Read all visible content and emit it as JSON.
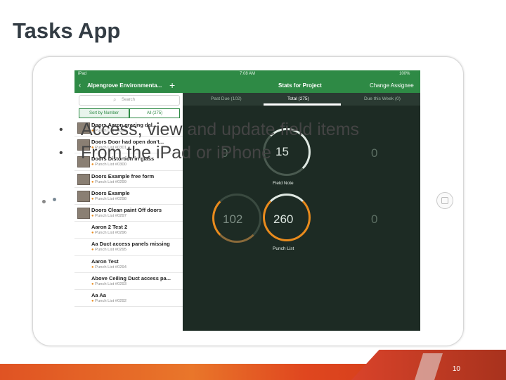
{
  "slide": {
    "title": "Tasks App",
    "page_number": "10"
  },
  "bullets": [
    "Access, view and update field items",
    "From the iPad or iPhone"
  ],
  "statusbar": {
    "carrier": "iPad",
    "time": "7:08 AM",
    "battery": "100%"
  },
  "nav": {
    "back_icon": "‹",
    "project": "Alpengrove Environmenta...",
    "add_icon": "+",
    "center_title": "Stats for Project",
    "right_action": "Change Assignee"
  },
  "search": {
    "icon": "⌕",
    "placeholder": "Search"
  },
  "segments": {
    "sort": "Sort by Number",
    "filter": "All (275)"
  },
  "tabs": {
    "past_due": "Past Due (102)",
    "total": "Total (275)",
    "due_week": "Due this Week (0)"
  },
  "list_items": [
    {
      "title": "Doors Aaron grazing dal...",
      "sub": "Punch List #0302",
      "thumb": true
    },
    {
      "title": "Doors Door had open don't...",
      "sub": "Punch List #0301",
      "thumb": true
    },
    {
      "title": "Doors Distortion in glass",
      "sub": "Punch List #0300",
      "thumb": true
    },
    {
      "title": "Doors Example free form",
      "sub": "Punch List #0299",
      "thumb": true
    },
    {
      "title": "Doors Example",
      "sub": "Punch List #0298",
      "thumb": true
    },
    {
      "title": "Doors Clean paint Off doors",
      "sub": "Punch List #0297",
      "thumb": true
    },
    {
      "title": "Aaron 2 Test 2",
      "sub": "Punch List #0296",
      "thumb": false
    },
    {
      "title": "Aa Duct access panels missing",
      "sub": "Punch List #0295",
      "thumb": false
    },
    {
      "title": "Aaron Test",
      "sub": "Punch List #0294",
      "thumb": false
    },
    {
      "title": "Above Ceiling Duct access pa...",
      "sub": "Punch List #0293",
      "thumb": false
    },
    {
      "title": "Aa Aa",
      "sub": "Punch List #0292",
      "thumb": false
    }
  ],
  "stats": {
    "field_note": {
      "past_due": "0",
      "total": "15",
      "due_week": "0",
      "label": "Field Note"
    },
    "punch_list": {
      "past_due": "102",
      "total": "260",
      "due_week": "0",
      "label": "Punch List"
    }
  },
  "colors": {
    "accent_green": "#2e8a45",
    "ring_orange": "#e98b1d",
    "footer_orange": "#e05323"
  }
}
